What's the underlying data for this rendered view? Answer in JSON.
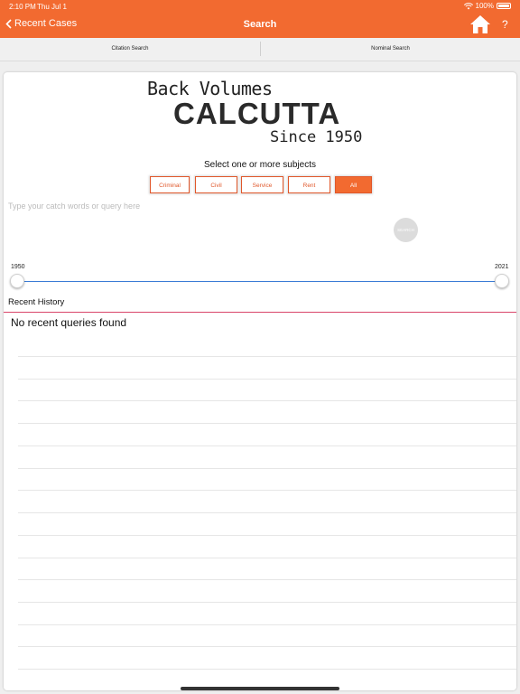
{
  "status": {
    "time": "2:10 PM",
    "date": "Thu Jul 1",
    "battery": "100%"
  },
  "nav": {
    "back_label": "Recent Cases",
    "title": "Search",
    "help_label": "?"
  },
  "segments": [
    "Citation Search",
    "Nominal Search"
  ],
  "logo": {
    "line1": "Back Volumes",
    "line2": "CALCUTTA",
    "line3": "Since 1950"
  },
  "subjects": {
    "prompt": "Select one or more subjects",
    "options": [
      "Criminal",
      "Civil",
      "Service",
      "Rent",
      "All"
    ],
    "selected": "All"
  },
  "query": {
    "placeholder": "Type your catch words or query here",
    "search_label": "SEARCH"
  },
  "year_range": {
    "min": "1950",
    "max": "2021"
  },
  "history": {
    "title": "Recent History",
    "empty": "No recent queries found"
  },
  "colors": {
    "accent": "#f26a30",
    "slider": "#3a7bd5",
    "history_rule": "#d9456a"
  }
}
